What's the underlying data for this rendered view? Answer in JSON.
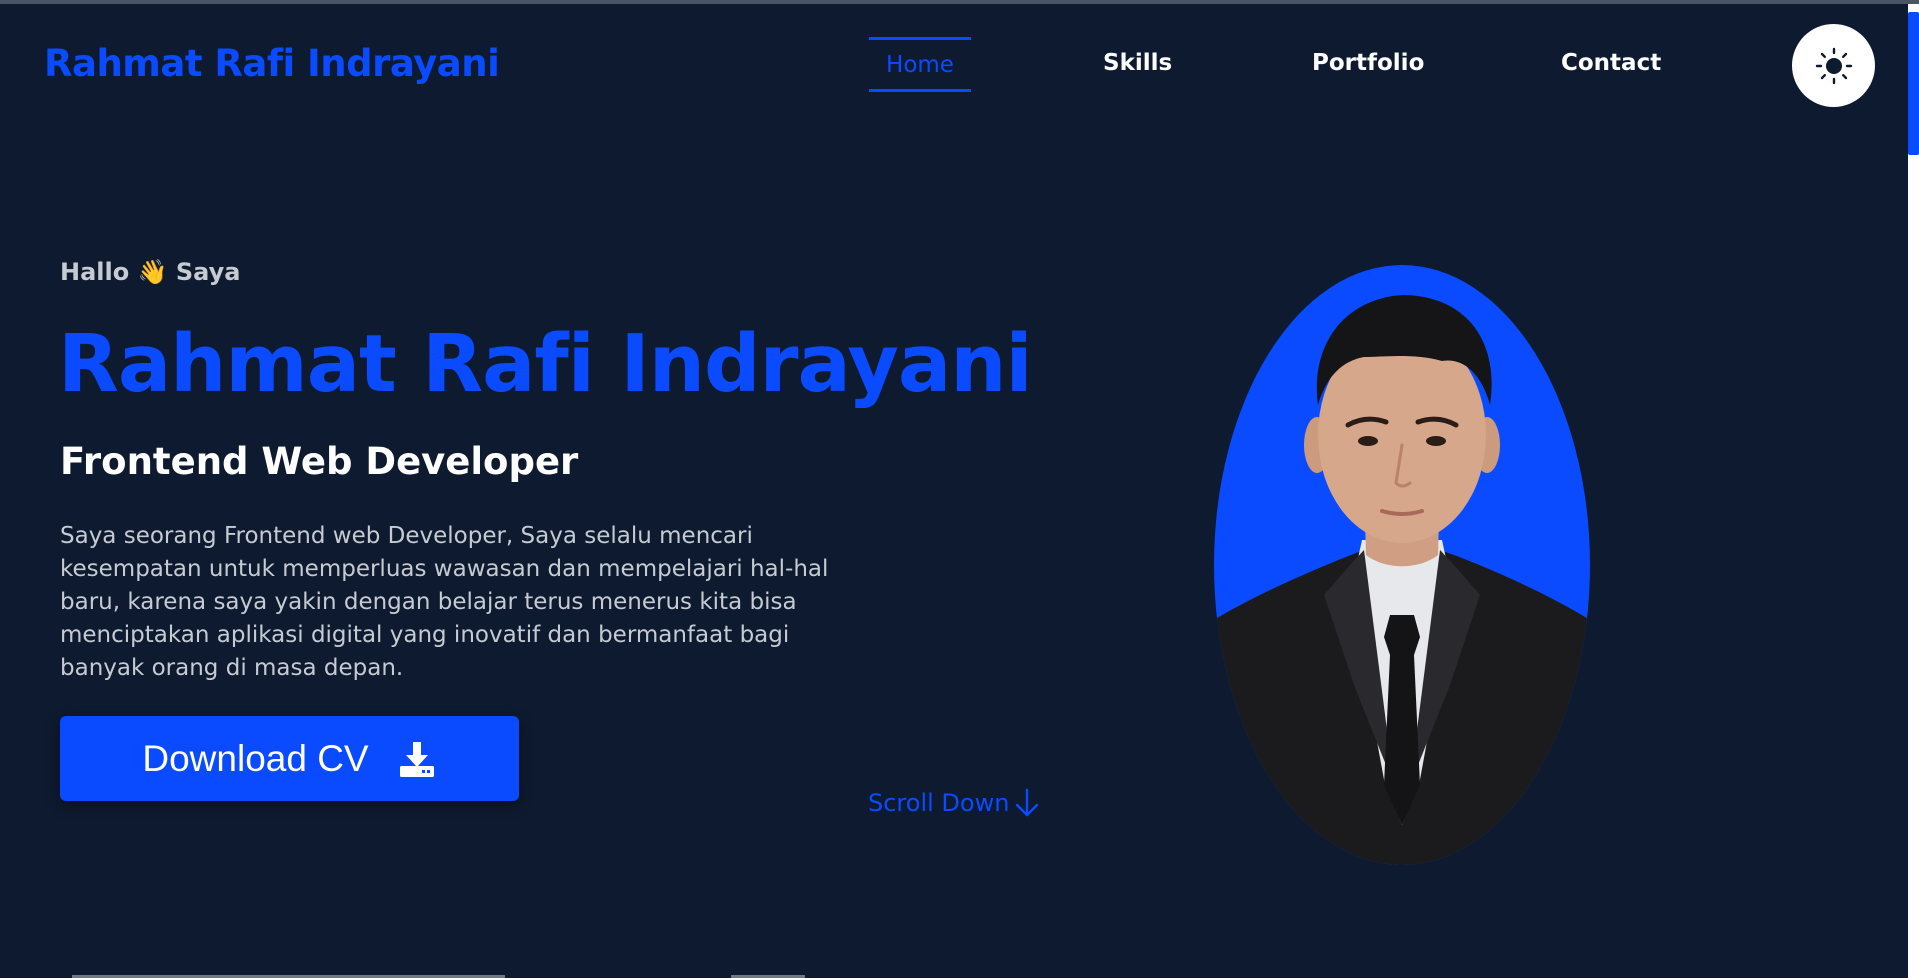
{
  "header": {
    "brand": "Rahmat Rafi Indrayani",
    "nav": [
      {
        "label": "Home",
        "active": true
      },
      {
        "label": "Skills",
        "active": false
      },
      {
        "label": "Portfolio",
        "active": false
      },
      {
        "label": "Contact",
        "active": false
      }
    ],
    "theme_toggle_icon": "sun-icon"
  },
  "hero": {
    "greeting_prefix": "Hallo",
    "greeting_emoji": "👋",
    "greeting_suffix": "Saya",
    "name": "Rahmat Rafi Indrayani",
    "role": "Frontend Web Developer",
    "description": "Saya seorang Frontend web Developer, Saya selalu mencari kesempatan untuk memperluas wawasan dan mempelajari hal-hal baru, karena saya yakin dengan belajar terus menerus kita bisa menciptakan aplikasi digital yang inovatif dan bermanfaat bagi banyak orang di masa depan.",
    "download_label": "Download CV",
    "download_icon": "download-icon",
    "scroll_label": "Scroll Down",
    "scroll_icon": "arrow-down-icon"
  },
  "colors": {
    "background": "#0e1a2f",
    "accent": "#0a4bff",
    "text": "#ffffff",
    "muted_text": "#c6cbd2"
  }
}
